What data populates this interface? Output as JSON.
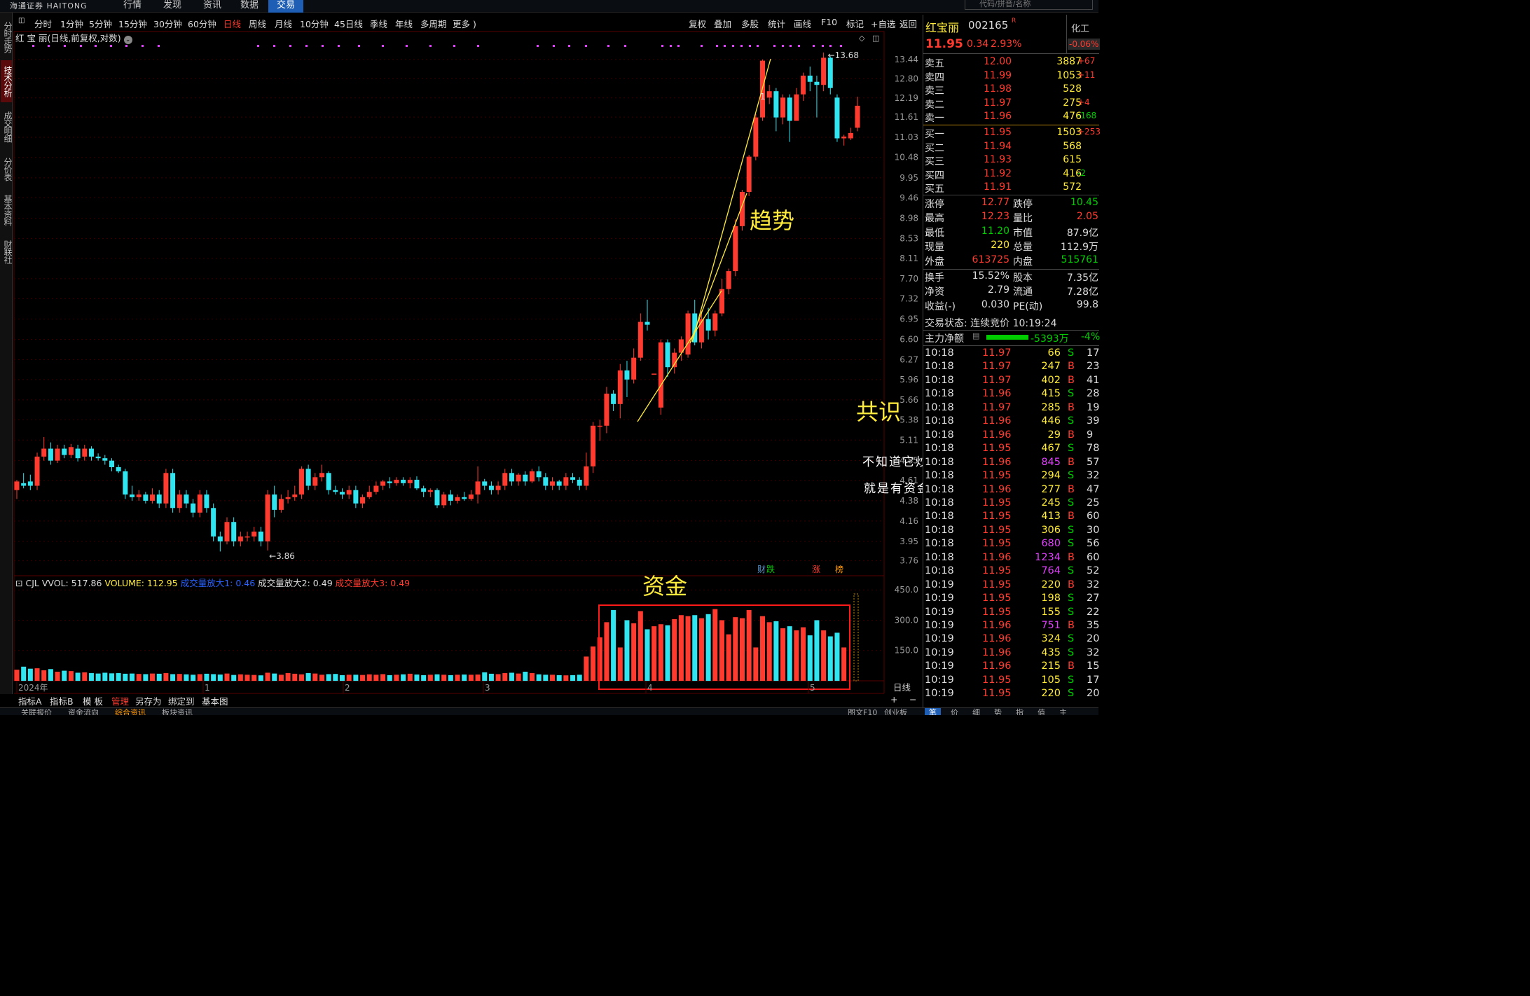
{
  "topnav": {
    "logo": "海通证券",
    "logo_en": "HAITONG",
    "items": [
      "行情",
      "发现",
      "资讯",
      "数据",
      "交易"
    ],
    "search_placeholder": "代码/拼音/名称"
  },
  "left_tabs": [
    "分时走势",
    "技术分析",
    "成交明细",
    "分价表",
    "基本资料",
    "财联社"
  ],
  "periods": [
    "分时",
    "1分钟",
    "5分钟",
    "15分钟",
    "30分钟",
    "60分钟",
    "日线",
    "周线",
    "月线",
    "10分钟",
    "45日线",
    "季线",
    "年线",
    "多周期",
    "更多 )"
  ],
  "toolbar_right": [
    "复权",
    "叠加",
    "多股",
    "统计",
    "画线",
    "F10",
    "标记",
    "+自选",
    "返回"
  ],
  "chart_title": "红 宝 丽(日线,前复权,对数)",
  "volume_header": {
    "name": "CJL",
    "vvol": "VVOL: 517.86",
    "volume": "VOLUME: 112.95",
    "amp1": "成交量放大1: 0.46",
    "amp2": "成交量放大2: 0.49",
    "amp3": "成交量放大3: 0.49"
  },
  "annotations": {
    "trend": "趋势",
    "consensus": "共识",
    "fund": "资金",
    "note1": "不知道它炒的啥",
    "note2": "就是有资金进场"
  },
  "markers": {
    "high": "13.68",
    "low": "3.86",
    "marker_1": "1"
  },
  "bottom_tabs": [
    "指标A",
    "指标B",
    "模 板",
    "管理",
    "另存为",
    "绑定到",
    "基本图"
  ],
  "axis_x": [
    "2024年",
    "1",
    "2",
    "3",
    "4",
    "5",
    "日线"
  ],
  "footer_tabs": [
    "关联报价",
    "资金流向",
    "综合资讯",
    "板块资讯",
    "图文F10",
    "创业板"
  ],
  "footer_right_tabs": [
    "笔",
    "价",
    "细",
    "势",
    "指",
    "值",
    "主"
  ],
  "signals": [
    {
      "text": "财",
      "color": "#5b9bd5"
    },
    {
      "text": "跌",
      "color": "#00cc00"
    },
    {
      "text": "涨",
      "color": "#ff3b30"
    },
    {
      "text": "榜",
      "color": "#ff9800"
    }
  ],
  "colors": {
    "up": "#ff3b30",
    "down": "#30e5f0",
    "trendline": "#ffeb3b",
    "grid": "#3a0000"
  },
  "stock": {
    "name": "红宝丽",
    "code": "002165",
    "flag": "R",
    "price": "11.95",
    "change": "0.34",
    "pct": "2.93%",
    "sector": "化工",
    "sector_pct": "-0.06%"
  },
  "order_book": {
    "sell": [
      {
        "label": "卖五",
        "price": "12.00",
        "vol": "3887",
        "chg": "+67",
        "chg_color": "#ff3b30"
      },
      {
        "label": "卖四",
        "price": "11.99",
        "vol": "1053",
        "chg": "+11",
        "chg_color": "#ff3b30"
      },
      {
        "label": "卖三",
        "price": "11.98",
        "vol": "528",
        "chg": "",
        "chg_color": "#ff3b30"
      },
      {
        "label": "卖二",
        "price": "11.97",
        "vol": "275",
        "chg": "+4",
        "chg_color": "#ff3b30"
      },
      {
        "label": "卖一",
        "price": "11.96",
        "vol": "476",
        "chg": "-168",
        "chg_color": "#00cc00"
      }
    ],
    "buy": [
      {
        "label": "买一",
        "price": "11.95",
        "vol": "1503",
        "chg": "+253",
        "chg_color": "#ff3b30"
      },
      {
        "label": "买二",
        "price": "11.94",
        "vol": "568",
        "chg": "",
        "chg_color": "#ff3b30"
      },
      {
        "label": "买三",
        "price": "11.93",
        "vol": "615",
        "chg": "",
        "chg_color": "#ff3b30"
      },
      {
        "label": "买四",
        "price": "11.92",
        "vol": "416",
        "chg": "-2",
        "chg_color": "#00cc00"
      },
      {
        "label": "买五",
        "price": "11.91",
        "vol": "572",
        "chg": "",
        "chg_color": "#ff3b30"
      }
    ]
  },
  "quote_stats": [
    {
      "l1": "涨停",
      "v1": "12.77",
      "c1": "#ff3b30",
      "l2": "跌停",
      "v2": "10.45",
      "c2": "#00cc00"
    },
    {
      "l1": "最高",
      "v1": "12.23",
      "c1": "#ff3b30",
      "l2": "量比",
      "v2": "2.05",
      "c2": "#ff3b30"
    },
    {
      "l1": "最低",
      "v1": "11.20",
      "c1": "#00cc00",
      "l2": "市值",
      "v2": "87.9亿",
      "c2": "#ddd"
    },
    {
      "l1": "现量",
      "v1": "220",
      "c1": "#ffeb3b",
      "l2": "总量",
      "v2": "112.9万",
      "c2": "#ddd"
    },
    {
      "l1": "外盘",
      "v1": "613725",
      "c1": "#ff3b30",
      "l2": "内盘",
      "v2": "515761",
      "c2": "#00cc00"
    }
  ],
  "quote_stats2": [
    {
      "l1": "换手",
      "v1": "15.52%",
      "c1": "#ddd",
      "l2": "股本",
      "v2": "7.35亿",
      "c2": "#ddd"
    },
    {
      "l1": "净资",
      "v1": "2.79",
      "c1": "#ddd",
      "l2": "流通",
      "v2": "7.28亿",
      "c2": "#ddd"
    },
    {
      "l1": "收益(-)",
      "v1": "0.030",
      "c1": "#ddd",
      "l2": "PE(动)",
      "v2": "99.8",
      "c2": "#ddd"
    }
  ],
  "trade_status": "交易状态: 连续竞价 10:19:24",
  "main_net": {
    "label": "主力净额",
    "value": "-5393万",
    "pct": "-4%"
  },
  "ticks": [
    {
      "t": "10:18",
      "p": "11.97",
      "v": "66",
      "s": "S",
      "n": "17"
    },
    {
      "t": "10:18",
      "p": "11.97",
      "v": "247",
      "s": "B",
      "n": "23"
    },
    {
      "t": "10:18",
      "p": "11.97",
      "v": "402",
      "s": "B",
      "n": "41"
    },
    {
      "t": "10:18",
      "p": "11.96",
      "v": "415",
      "s": "S",
      "n": "28"
    },
    {
      "t": "10:18",
      "p": "11.97",
      "v": "285",
      "s": "B",
      "n": "19"
    },
    {
      "t": "10:18",
      "p": "11.96",
      "v": "446",
      "s": "S",
      "n": "39"
    },
    {
      "t": "10:18",
      "p": "11.96",
      "v": "29",
      "s": "B",
      "n": "9"
    },
    {
      "t": "10:18",
      "p": "11.95",
      "v": "467",
      "s": "S",
      "n": "78"
    },
    {
      "t": "10:18",
      "p": "11.96",
      "v": "845",
      "s": "B",
      "n": "57",
      "big": true
    },
    {
      "t": "10:18",
      "p": "11.95",
      "v": "294",
      "s": "S",
      "n": "32"
    },
    {
      "t": "10:18",
      "p": "11.96",
      "v": "277",
      "s": "B",
      "n": "47"
    },
    {
      "t": "10:18",
      "p": "11.95",
      "v": "245",
      "s": "S",
      "n": "25"
    },
    {
      "t": "10:18",
      "p": "11.95",
      "v": "413",
      "s": "B",
      "n": "60"
    },
    {
      "t": "10:18",
      "p": "11.95",
      "v": "306",
      "s": "S",
      "n": "30"
    },
    {
      "t": "10:18",
      "p": "11.95",
      "v": "680",
      "s": "S",
      "n": "56",
      "big": true
    },
    {
      "t": "10:18",
      "p": "11.96",
      "v": "1234",
      "s": "B",
      "n": "60",
      "big": true
    },
    {
      "t": "10:18",
      "p": "11.95",
      "v": "764",
      "s": "S",
      "n": "52",
      "big": true
    },
    {
      "t": "10:19",
      "p": "11.95",
      "v": "220",
      "s": "B",
      "n": "32"
    },
    {
      "t": "10:19",
      "p": "11.95",
      "v": "198",
      "s": "S",
      "n": "27"
    },
    {
      "t": "10:19",
      "p": "11.95",
      "v": "155",
      "s": "S",
      "n": "22"
    },
    {
      "t": "10:19",
      "p": "11.96",
      "v": "751",
      "s": "B",
      "n": "35",
      "big": true
    },
    {
      "t": "10:19",
      "p": "11.96",
      "v": "324",
      "s": "S",
      "n": "20"
    },
    {
      "t": "10:19",
      "p": "11.96",
      "v": "435",
      "s": "S",
      "n": "32"
    },
    {
      "t": "10:19",
      "p": "11.96",
      "v": "215",
      "s": "B",
      "n": "15"
    },
    {
      "t": "10:19",
      "p": "11.95",
      "v": "105",
      "s": "S",
      "n": "17"
    },
    {
      "t": "10:19",
      "p": "11.95",
      "v": "220",
      "s": "S",
      "n": "20"
    }
  ],
  "chart_data": {
    "type": "candlestick",
    "title": "红 宝 丽(日线,前复权,对数)",
    "y_scale": "log",
    "y_ticks": [
      13.44,
      12.8,
      12.19,
      11.61,
      11.03,
      10.48,
      9.95,
      9.46,
      8.98,
      8.53,
      8.11,
      7.7,
      7.32,
      6.95,
      6.6,
      6.27,
      5.96,
      5.66,
      5.38,
      5.11,
      4.85,
      4.61,
      4.38,
      4.16,
      3.95,
      3.76
    ],
    "y_tick_labels": [
      "13.44",
      "12.80",
      "12.19",
      "11.61",
      "11.03",
      "10.48",
      "9.95",
      "9.46",
      "8.98",
      "8.53",
      "8.11",
      "7.70",
      "7.32",
      "6.95",
      "6.60",
      "6.27",
      "5.96",
      "5.66",
      "5.38",
      "5.11",
      "4.85",
      "4.61",
      "4.38",
      "4.16",
      "3.95",
      "3.76"
    ],
    "ylim": [
      3.62,
      14.0
    ],
    "vol_ticks": [
      150,
      300,
      450
    ],
    "vol_tick_labels": [
      "150.0",
      "300.0",
      "450.0"
    ],
    "high": 13.68,
    "low": 3.86,
    "candles": [
      [
        4.5,
        4.6,
        4.4,
        4.62
      ],
      [
        4.58,
        4.55,
        4.52,
        4.7
      ],
      [
        4.6,
        4.55,
        4.5,
        4.68
      ],
      [
        4.55,
        4.9,
        4.5,
        4.95
      ],
      [
        4.9,
        5.0,
        4.85,
        5.15
      ],
      [
        5.0,
        4.85,
        4.8,
        5.08
      ],
      [
        4.85,
        5.0,
        4.82,
        5.05
      ],
      [
        5.0,
        4.92,
        4.88,
        5.05
      ],
      [
        4.92,
        5.02,
        4.88,
        5.06
      ],
      [
        5.0,
        4.88,
        4.84,
        5.05
      ],
      [
        4.9,
        5.0,
        4.85,
        5.05
      ],
      [
        5.0,
        4.9,
        4.85,
        5.03
      ],
      [
        4.9,
        4.88,
        4.85,
        4.94
      ],
      [
        4.88,
        4.85,
        4.8,
        4.92
      ],
      [
        4.85,
        4.77,
        4.72,
        4.88
      ],
      [
        4.77,
        4.72,
        4.7,
        4.8
      ],
      [
        4.72,
        4.45,
        4.4,
        4.75
      ],
      [
        4.45,
        4.42,
        4.38,
        4.55
      ],
      [
        4.42,
        4.45,
        4.38,
        4.5
      ],
      [
        4.45,
        4.38,
        4.35,
        4.48
      ],
      [
        4.38,
        4.45,
        4.35,
        4.52
      ],
      [
        4.45,
        4.35,
        4.3,
        4.5
      ],
      [
        4.35,
        4.7,
        4.3,
        4.75
      ],
      [
        4.7,
        4.3,
        4.25,
        4.75
      ],
      [
        4.3,
        4.45,
        4.25,
        4.5
      ],
      [
        4.45,
        4.35,
        4.3,
        4.5
      ],
      [
        4.35,
        4.25,
        4.2,
        4.4
      ],
      [
        4.25,
        4.45,
        4.2,
        4.5
      ],
      [
        4.45,
        4.3,
        4.25,
        4.5
      ],
      [
        4.3,
        4.0,
        3.95,
        4.35
      ],
      [
        4.0,
        3.95,
        3.85,
        4.05
      ],
      [
        3.95,
        4.15,
        3.92,
        4.2
      ],
      [
        4.15,
        3.95,
        3.9,
        4.2
      ],
      [
        3.95,
        4.0,
        3.9,
        4.05
      ],
      [
        4.0,
        4.0,
        3.95,
        4.05
      ],
      [
        4.0,
        4.05,
        3.95,
        4.1
      ],
      [
        4.05,
        3.95,
        3.9,
        4.1
      ],
      [
        3.95,
        4.45,
        3.86,
        4.5
      ],
      [
        4.45,
        4.28,
        4.2,
        4.55
      ],
      [
        4.28,
        4.4,
        4.25,
        4.45
      ],
      [
        4.4,
        4.42,
        4.35,
        4.5
      ],
      [
        4.42,
        4.45,
        4.38,
        4.55
      ],
      [
        4.45,
        4.75,
        4.4,
        4.78
      ],
      [
        4.75,
        4.55,
        4.5,
        4.8
      ],
      [
        4.55,
        4.65,
        4.5,
        4.7
      ],
      [
        4.65,
        4.7,
        4.6,
        4.8
      ],
      [
        4.7,
        4.5,
        4.45,
        4.72
      ],
      [
        4.5,
        4.48,
        4.45,
        4.55
      ],
      [
        4.48,
        4.45,
        4.4,
        4.52
      ],
      [
        4.45,
        4.5,
        4.4,
        4.55
      ],
      [
        4.5,
        4.35,
        4.3,
        4.55
      ],
      [
        4.35,
        4.42,
        4.3,
        4.45
      ],
      [
        4.42,
        4.48,
        4.4,
        4.55
      ],
      [
        4.48,
        4.55,
        4.45,
        4.6
      ],
      [
        4.55,
        4.6,
        4.5,
        4.62
      ],
      [
        4.6,
        4.58,
        4.52,
        4.65
      ],
      [
        4.58,
        4.62,
        4.55,
        4.65
      ],
      [
        4.62,
        4.58,
        4.55,
        4.65
      ],
      [
        4.58,
        4.62,
        4.52,
        4.65
      ],
      [
        4.62,
        4.52,
        4.5,
        4.66
      ],
      [
        4.52,
        4.48,
        4.42,
        4.55
      ],
      [
        4.48,
        4.5,
        4.42,
        4.52
      ],
      [
        4.5,
        4.33,
        4.3,
        4.52
      ],
      [
        4.33,
        4.45,
        4.3,
        4.48
      ],
      [
        4.45,
        4.38,
        4.33,
        4.5
      ],
      [
        4.38,
        4.42,
        4.35,
        4.45
      ],
      [
        4.42,
        4.4,
        4.38,
        4.48
      ],
      [
        4.4,
        4.45,
        4.38,
        4.5
      ],
      [
        4.45,
        4.6,
        4.35,
        4.78
      ],
      [
        4.6,
        4.55,
        4.5,
        4.63
      ],
      [
        4.55,
        4.5,
        4.45,
        4.6
      ],
      [
        4.5,
        4.55,
        4.45,
        4.6
      ],
      [
        4.55,
        4.7,
        4.5,
        4.75
      ],
      [
        4.7,
        4.6,
        4.55,
        4.75
      ],
      [
        4.6,
        4.68,
        4.55,
        4.7
      ],
      [
        4.68,
        4.6,
        4.55,
        4.72
      ],
      [
        4.6,
        4.72,
        4.58,
        4.75
      ],
      [
        4.72,
        4.65,
        4.6,
        4.78
      ],
      [
        4.65,
        4.55,
        4.5,
        4.7
      ],
      [
        4.55,
        4.6,
        4.5,
        4.65
      ],
      [
        4.6,
        4.55,
        4.5,
        4.62
      ],
      [
        4.55,
        4.65,
        4.5,
        4.7
      ],
      [
        4.65,
        4.62,
        4.58,
        4.7
      ],
      [
        4.62,
        4.55,
        4.5,
        4.65
      ],
      [
        4.55,
        4.78,
        4.5,
        4.95
      ],
      [
        4.78,
        5.3,
        4.7,
        5.35
      ],
      [
        5.3,
        5.3,
        5.1,
        5.38
      ],
      [
        5.3,
        5.75,
        5.2,
        5.85
      ],
      [
        5.75,
        5.6,
        5.5,
        5.8
      ],
      [
        5.6,
        6.1,
        5.4,
        6.2
      ],
      [
        6.1,
        5.96,
        5.7,
        6.25
      ],
      [
        5.96,
        6.3,
        5.9,
        6.45
      ],
      [
        6.3,
        6.9,
        6.25,
        7.05
      ],
      [
        6.9,
        6.85,
        6.75,
        7.3
      ],
      [
        6.05,
        6.05,
        6.05,
        6.05
      ],
      [
        5.55,
        6.55,
        5.45,
        6.6
      ],
      [
        6.55,
        6.15,
        6.0,
        6.6
      ],
      [
        6.15,
        6.38,
        6.05,
        6.45
      ],
      [
        6.38,
        6.6,
        6.25,
        6.65
      ],
      [
        6.35,
        7.05,
        6.3,
        7.1
      ],
      [
        7.05,
        6.55,
        6.5,
        7.3
      ],
      [
        6.55,
        6.95,
        6.45,
        7.1
      ],
      [
        6.95,
        6.75,
        6.6,
        7.15
      ],
      [
        6.75,
        7.05,
        6.65,
        7.1
      ],
      [
        7.05,
        7.5,
        7.0,
        7.7
      ],
      [
        7.5,
        7.85,
        7.4,
        7.9
      ],
      [
        7.85,
        8.8,
        7.75,
        8.95
      ],
      [
        8.8,
        9.6,
        8.7,
        9.65
      ],
      [
        9.6,
        10.5,
        9.5,
        10.55
      ],
      [
        10.5,
        11.6,
        10.4,
        11.7
      ],
      [
        11.6,
        13.4,
        11.5,
        13.44
      ],
      [
        12.2,
        12.4,
        12.0,
        12.6
      ],
      [
        12.4,
        11.6,
        11.2,
        12.5
      ],
      [
        11.6,
        12.2,
        11.4,
        12.3
      ],
      [
        12.2,
        11.5,
        10.9,
        12.3
      ],
      [
        11.5,
        12.3,
        11.5,
        12.5
      ],
      [
        12.3,
        12.9,
        12.1,
        13.0
      ],
      [
        12.9,
        12.7,
        12.4,
        13.2
      ],
      [
        12.7,
        12.6,
        11.6,
        12.9
      ],
      [
        12.6,
        13.5,
        12.4,
        13.68
      ],
      [
        13.5,
        12.5,
        12.3,
        13.55
      ],
      [
        12.2,
        11.0,
        10.9,
        12.3
      ],
      [
        11.0,
        11.05,
        10.8,
        11.1
      ],
      [
        11.0,
        11.15,
        10.95,
        11.3
      ],
      [
        11.3,
        11.95,
        11.2,
        12.23
      ]
    ],
    "volumes": [
      55,
      70,
      60,
      62,
      52,
      58,
      45,
      50,
      48,
      40,
      42,
      38,
      36,
      40,
      37,
      38,
      35,
      36,
      34,
      33,
      36,
      35,
      38,
      33,
      34,
      32,
      30,
      33,
      35,
      33,
      31,
      36,
      29,
      32,
      30,
      29,
      27,
      40,
      36,
      30,
      38,
      35,
      32,
      38,
      36,
      30,
      33,
      34,
      28,
      30,
      30,
      29,
      32,
      30,
      33,
      28,
      30,
      32,
      35,
      31,
      28,
      30,
      32,
      30,
      28,
      30,
      31,
      30,
      31,
      42,
      35,
      33,
      38,
      40,
      36,
      45,
      38,
      32,
      30,
      30,
      28,
      27,
      28,
      30,
      120,
      170,
      215,
      290,
      350,
      165,
      300,
      285,
      345,
      255,
      270,
      280,
      275,
      305,
      325,
      320,
      325,
      310,
      330,
      355,
      300,
      230,
      315,
      310,
      350,
      165,
      320,
      290,
      295,
      260,
      270,
      250,
      265,
      225,
      300,
      250,
      220,
      238,
      165
    ]
  }
}
